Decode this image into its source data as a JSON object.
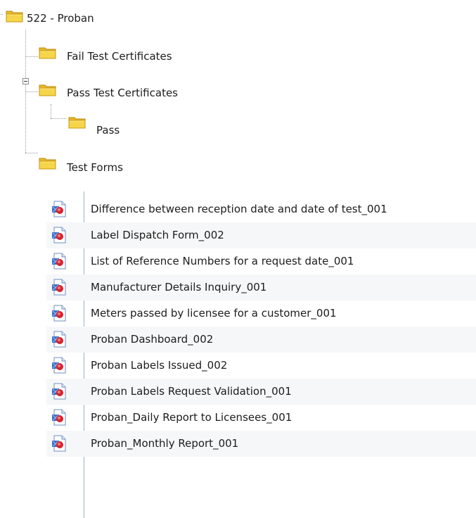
{
  "tree": {
    "root": {
      "label": "522 - Proban",
      "icon": "folder-icon"
    },
    "children": [
      {
        "label": "Fail Test Certificates",
        "icon": "folder-icon"
      },
      {
        "label": "Pass Test Certificates",
        "icon": "folder-icon",
        "expanded": true,
        "children": [
          {
            "label": "Pass",
            "icon": "folder-icon"
          }
        ]
      },
      {
        "label": "Test Forms",
        "icon": "folder-icon"
      }
    ]
  },
  "files": [
    {
      "name": "Difference between reception date and date of test_001",
      "icon": "pdf-report-icon"
    },
    {
      "name": "Label Dispatch Form_002",
      "icon": "pdf-report-icon"
    },
    {
      "name": "List of Reference Numbers for a request date_001",
      "icon": "pdf-report-icon"
    },
    {
      "name": "Manufacturer Details Inquiry_001",
      "icon": "pdf-report-icon"
    },
    {
      "name": "Meters passed by licensee for a customer_001",
      "icon": "pdf-report-icon"
    },
    {
      "name": "Proban Dashboard_002",
      "icon": "pdf-report-icon"
    },
    {
      "name": "Proban Labels Issued_002",
      "icon": "pdf-report-icon"
    },
    {
      "name": "Proban Labels Request Validation_001",
      "icon": "pdf-report-icon"
    },
    {
      "name": "Proban_Daily Report to Licensees_001",
      "icon": "pdf-report-icon"
    },
    {
      "name": "Proban_Monthly Report_001",
      "icon": "pdf-report-icon"
    }
  ],
  "colors": {
    "folder": "#f2cf3a",
    "folder_edge": "#c69a12",
    "pdf_red": "#d9212b",
    "pdf_blue": "#3d6fc4"
  }
}
